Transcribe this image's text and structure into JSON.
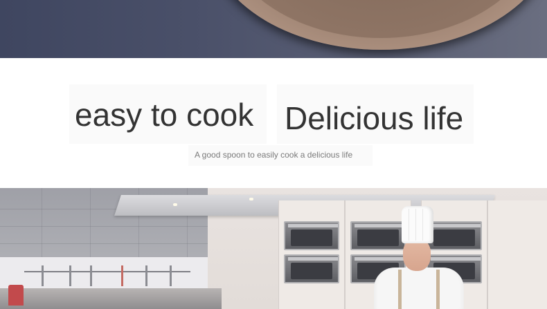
{
  "banner": {
    "image": "ceramic-plate-on-dark-surface"
  },
  "headline": {
    "left": "easy to cook",
    "right": "Delicious life"
  },
  "subtitle": "A good spoon to easily cook a delicious life",
  "photo": {
    "image": "chef-in-professional-kitchen"
  },
  "colors": {
    "headline_text": "#333333",
    "subtitle_text": "#7a7a7a",
    "banner_bg": "#4a5069",
    "plate": "#9c8170"
  }
}
